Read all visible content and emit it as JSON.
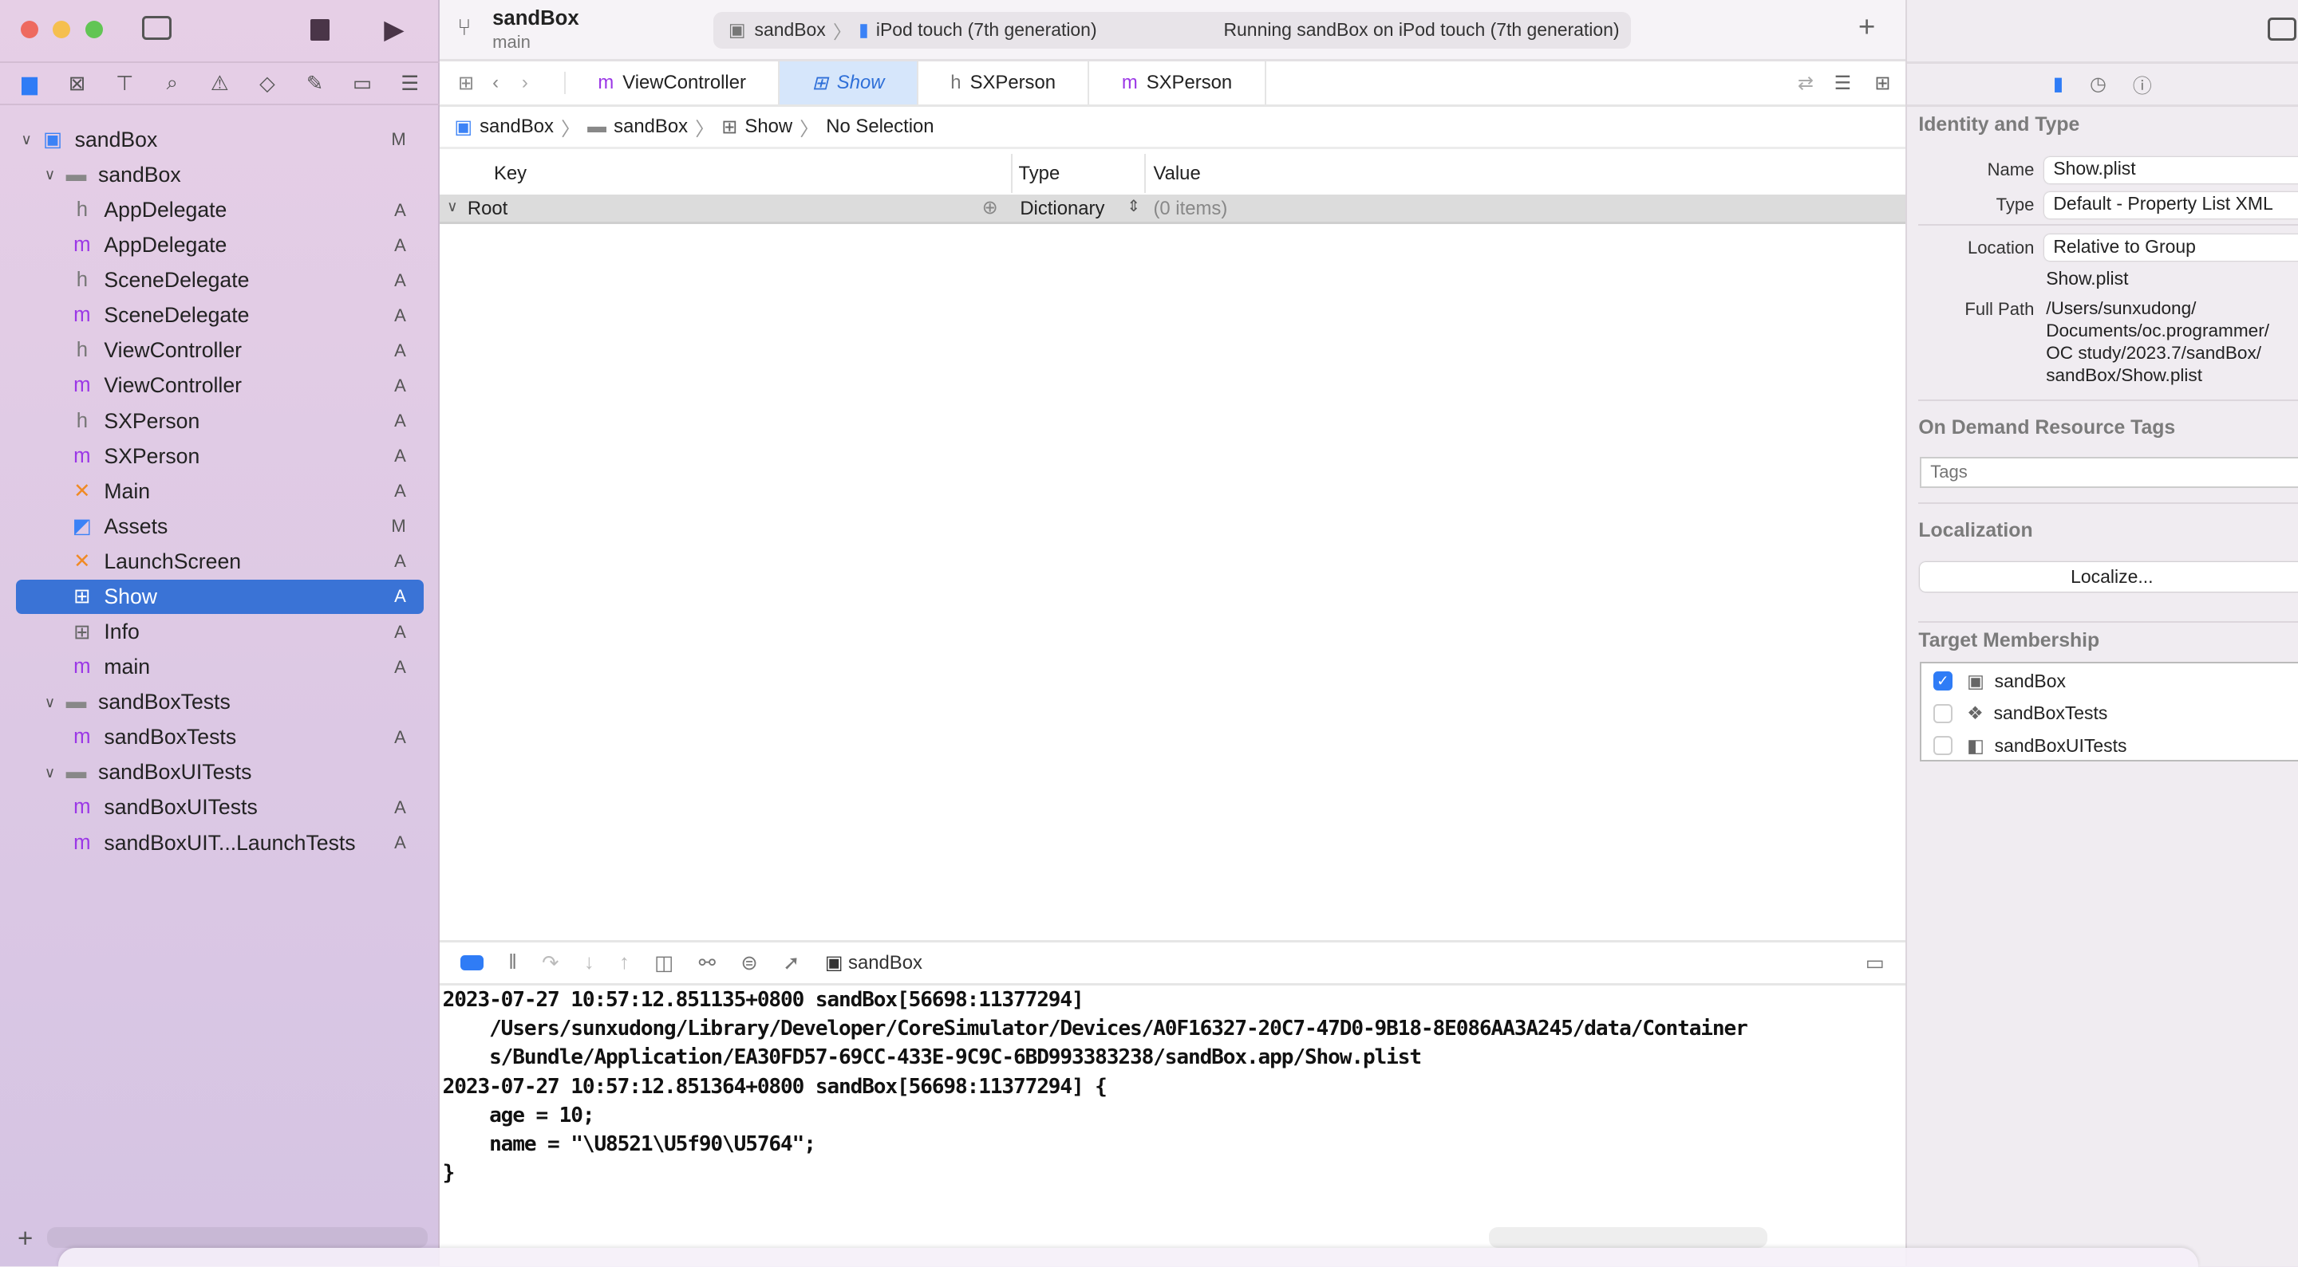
{
  "toolbar": {
    "project": "sandBox",
    "branch": "main",
    "scheme": "sandBox",
    "device": "iPod touch (7th generation)",
    "status": "Running sandBox on iPod touch (7th generation)"
  },
  "tabs": [
    {
      "icon": "m",
      "label": "ViewController"
    },
    {
      "icon": "grid",
      "label": "Show"
    },
    {
      "icon": "h",
      "label": "SXPerson"
    },
    {
      "icon": "m",
      "label": "SXPerson"
    }
  ],
  "breadcrumb": [
    "sandBox",
    "sandBox",
    "Show",
    "No Selection"
  ],
  "plist": {
    "headers": {
      "key": "Key",
      "type": "Type",
      "value": "Value"
    },
    "root": {
      "key": "Root",
      "type": "Dictionary",
      "value": "(0 items)"
    }
  },
  "navigator": [
    {
      "label": "sandBox",
      "icon": "app",
      "badge": "M",
      "level": 0,
      "chevron": true
    },
    {
      "label": "sandBox",
      "icon": "folder",
      "badge": "",
      "level": 1,
      "chevron": true
    },
    {
      "label": "AppDelegate",
      "icon": "h",
      "badge": "A",
      "level": 2
    },
    {
      "label": "AppDelegate",
      "icon": "m",
      "badge": "A",
      "level": 2
    },
    {
      "label": "SceneDelegate",
      "icon": "h",
      "badge": "A",
      "level": 2
    },
    {
      "label": "SceneDelegate",
      "icon": "m",
      "badge": "A",
      "level": 2
    },
    {
      "label": "ViewController",
      "icon": "h",
      "badge": "A",
      "level": 2
    },
    {
      "label": "ViewController",
      "icon": "m",
      "badge": "A",
      "level": 2
    },
    {
      "label": "SXPerson",
      "icon": "h",
      "badge": "A",
      "level": 2
    },
    {
      "label": "SXPerson",
      "icon": "m",
      "badge": "A",
      "level": 2
    },
    {
      "label": "Main",
      "icon": "x",
      "badge": "A",
      "level": 2
    },
    {
      "label": "Assets",
      "icon": "assets",
      "badge": "M",
      "level": 2
    },
    {
      "label": "LaunchScreen",
      "icon": "x",
      "badge": "A",
      "level": 2
    },
    {
      "label": "Show",
      "icon": "grid",
      "badge": "A",
      "level": 2,
      "selected": true
    },
    {
      "label": "Info",
      "icon": "grid",
      "badge": "A",
      "level": 2
    },
    {
      "label": "main",
      "icon": "m",
      "badge": "A",
      "level": 2
    },
    {
      "label": "sandBoxTests",
      "icon": "folder",
      "badge": "",
      "level": 1,
      "chevron": true
    },
    {
      "label": "sandBoxTests",
      "icon": "m",
      "badge": "A",
      "level": 2
    },
    {
      "label": "sandBoxUITests",
      "icon": "folder",
      "badge": "",
      "level": 1,
      "chevron": true
    },
    {
      "label": "sandBoxUITests",
      "icon": "m",
      "badge": "A",
      "level": 2
    },
    {
      "label": "sandBoxUIT...LaunchTests",
      "icon": "m",
      "badge": "A",
      "level": 2
    }
  ],
  "debug": {
    "target": "sandBox"
  },
  "console": [
    "2023-07-27 10:57:12.851135+0800 sandBox[56698:11377294]",
    "    /Users/sunxudong/Library/Developer/CoreSimulator/Devices/A0F16327-20C7-47D0-9B18-8E086AA3A245/data/Container",
    "    s/Bundle/Application/EA30FD57-69CC-433E-9C9C-6BD993383238/sandBox.app/Show.plist",
    "2023-07-27 10:57:12.851364+0800 sandBox[56698:11377294] {",
    "    age = 10;",
    "    name = \"\\U8521\\U5f90\\U5764\";",
    "}"
  ],
  "inspector": {
    "identity_title": "Identity and Type",
    "name_label": "Name",
    "name": "Show.plist",
    "type_label": "Type",
    "type": "Default - Property List XML",
    "location_label": "Location",
    "location": "Relative to Group",
    "filename": "Show.plist",
    "fullpath_label": "Full Path",
    "fullpath": [
      "/Users/sunxudong/",
      "Documents/oc.programmer/",
      "OC study/2023.7/sandBox/",
      "sandBox/Show.plist"
    ],
    "odr_title": "On Demand Resource Tags",
    "tags_placeholder": "Tags",
    "loc_title": "Localization",
    "localize_button": "Localize...",
    "tm_title": "Target Membership",
    "targets": [
      {
        "label": "sandBox",
        "checked": true
      },
      {
        "label": "sandBoxTests",
        "checked": false
      },
      {
        "label": "sandBoxUITests",
        "checked": false
      }
    ]
  },
  "colors": {
    "accent": "#3a73d6",
    "sidebar": "#e6cfe6"
  }
}
